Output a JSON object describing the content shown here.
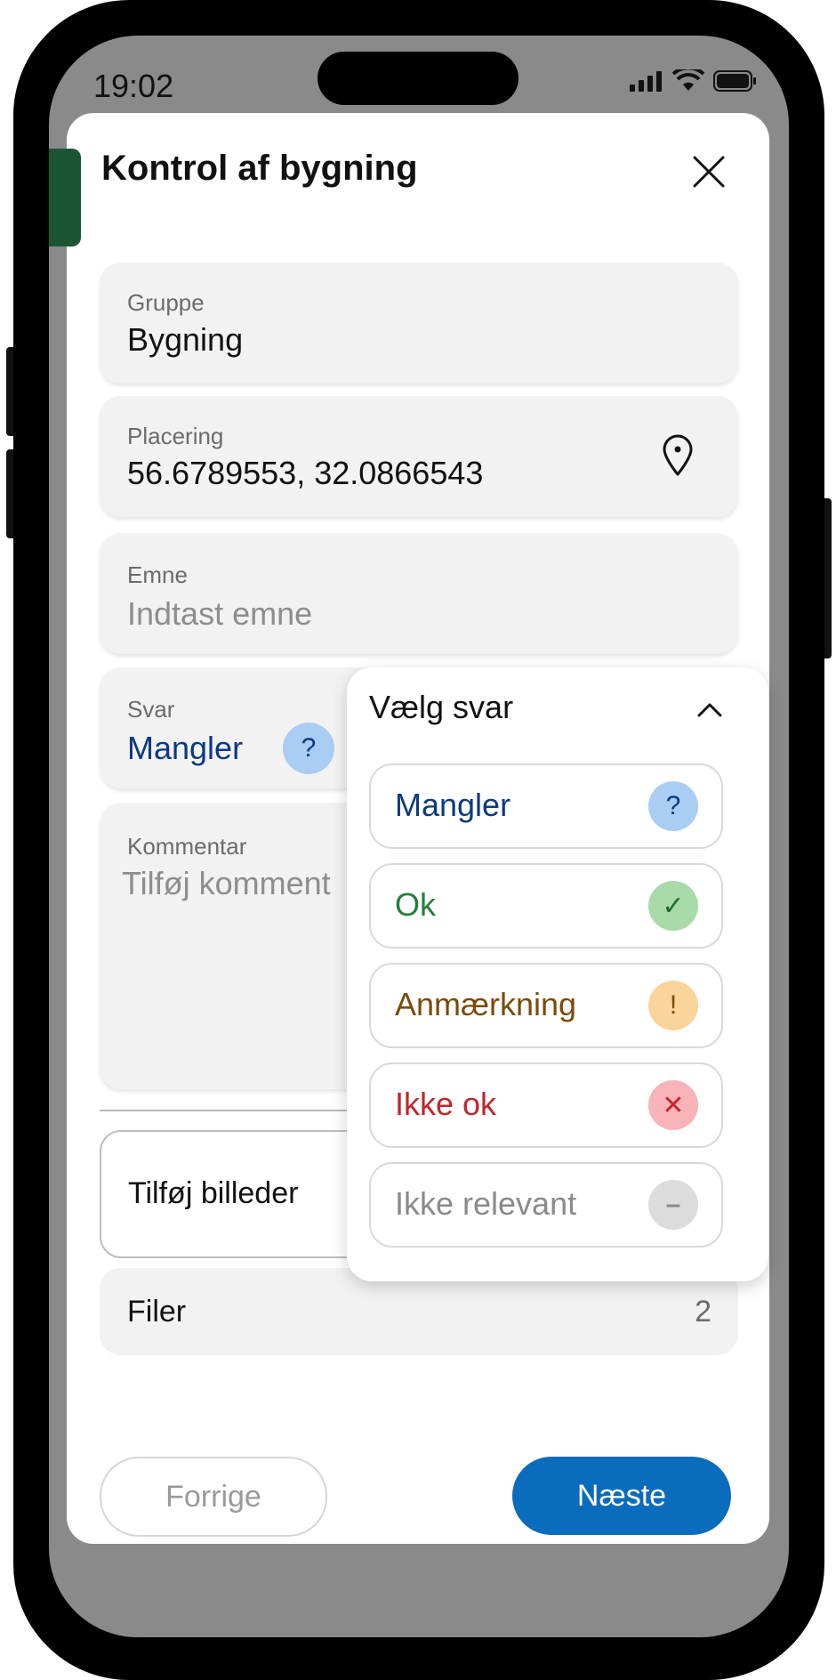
{
  "status_bar": {
    "time": "19:02"
  },
  "header": {
    "title": "Kontrol af bygning"
  },
  "fields": {
    "group": {
      "label": "Gruppe",
      "value": "Bygning"
    },
    "location": {
      "label": "Placering",
      "value": "56.6789553, 32.0866543"
    },
    "subject": {
      "label": "Emne",
      "placeholder": "Indtast emne"
    },
    "answer": {
      "label": "Svar",
      "value": "Mangler",
      "badge": "?"
    },
    "comment": {
      "label": "Kommentar",
      "placeholder": "Tilføj komment"
    }
  },
  "attachments": {
    "add_images_label": "Tilføj billeder",
    "files_label": "Filer",
    "files_count": "2"
  },
  "footer": {
    "prev_label": "Forrige",
    "next_label": "Næste"
  },
  "dropdown": {
    "title": "Vælg svar",
    "options": [
      {
        "label": "Mangler",
        "symbol": "?",
        "color": "#0b3a82",
        "badge_bg": "#a9cdf3"
      },
      {
        "label": "Ok",
        "symbol": "✓",
        "color": "#22803a",
        "badge_bg": "#a8dba9"
      },
      {
        "label": "Anmærkning",
        "symbol": "!",
        "color": "#7a4a0a",
        "badge_bg": "#fbd49c"
      },
      {
        "label": "Ikke ok",
        "symbol": "✕",
        "color": "#c1272d",
        "badge_bg": "#f7b3b8"
      },
      {
        "label": "Ikke relevant",
        "symbol": "–",
        "color": "#8a8a8a",
        "badge_bg": "#dcdcdc"
      }
    ]
  },
  "colors": {
    "accent": "#1a5632",
    "primary": "#0a6cbd",
    "answer_text": "#0b3a82"
  }
}
